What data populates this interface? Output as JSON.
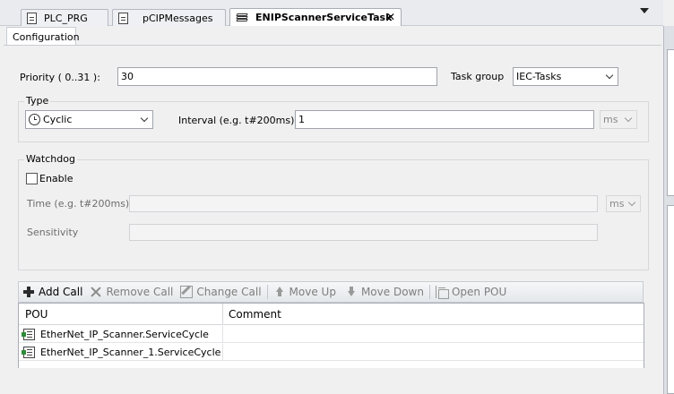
{
  "tabs": [
    {
      "label": "PLC_PRG",
      "icon": "document-icon"
    },
    {
      "label": "pCIPMessages",
      "icon": "document-icon"
    },
    {
      "label": "ENIPScannerServiceTask",
      "icon": "task-icon",
      "active": true
    }
  ],
  "subtab": {
    "label": "Configuration"
  },
  "config": {
    "priority_label": "Priority ( 0..31 ):",
    "priority_value": "30",
    "task_group_label": "Task group",
    "task_group_value": "IEC-Tasks"
  },
  "type_group": {
    "title": "Type",
    "type_value": "Cyclic",
    "interval_label": "Interval (e.g. t#200ms)",
    "interval_value": "1",
    "interval_unit": "ms"
  },
  "watchdog": {
    "title": "Watchdog",
    "enable_label": "Enable",
    "enabled": false,
    "time_label": "Time (e.g. t#200ms)",
    "time_value": "",
    "time_unit": "ms",
    "sensitivity_label": "Sensitivity",
    "sensitivity_value": ""
  },
  "toolbar": {
    "add_call": "Add Call",
    "remove_call": "Remove Call",
    "change_call": "Change Call",
    "move_up": "Move Up",
    "move_down": "Move Down",
    "open_pou": "Open POU"
  },
  "table": {
    "columns": [
      "POU",
      "Comment"
    ],
    "rows": [
      {
        "pou": "EtherNet_IP_Scanner.ServiceCycle",
        "comment": ""
      },
      {
        "pou": "EtherNet_IP_Scanner_1.ServiceCycle",
        "comment": ""
      }
    ]
  }
}
